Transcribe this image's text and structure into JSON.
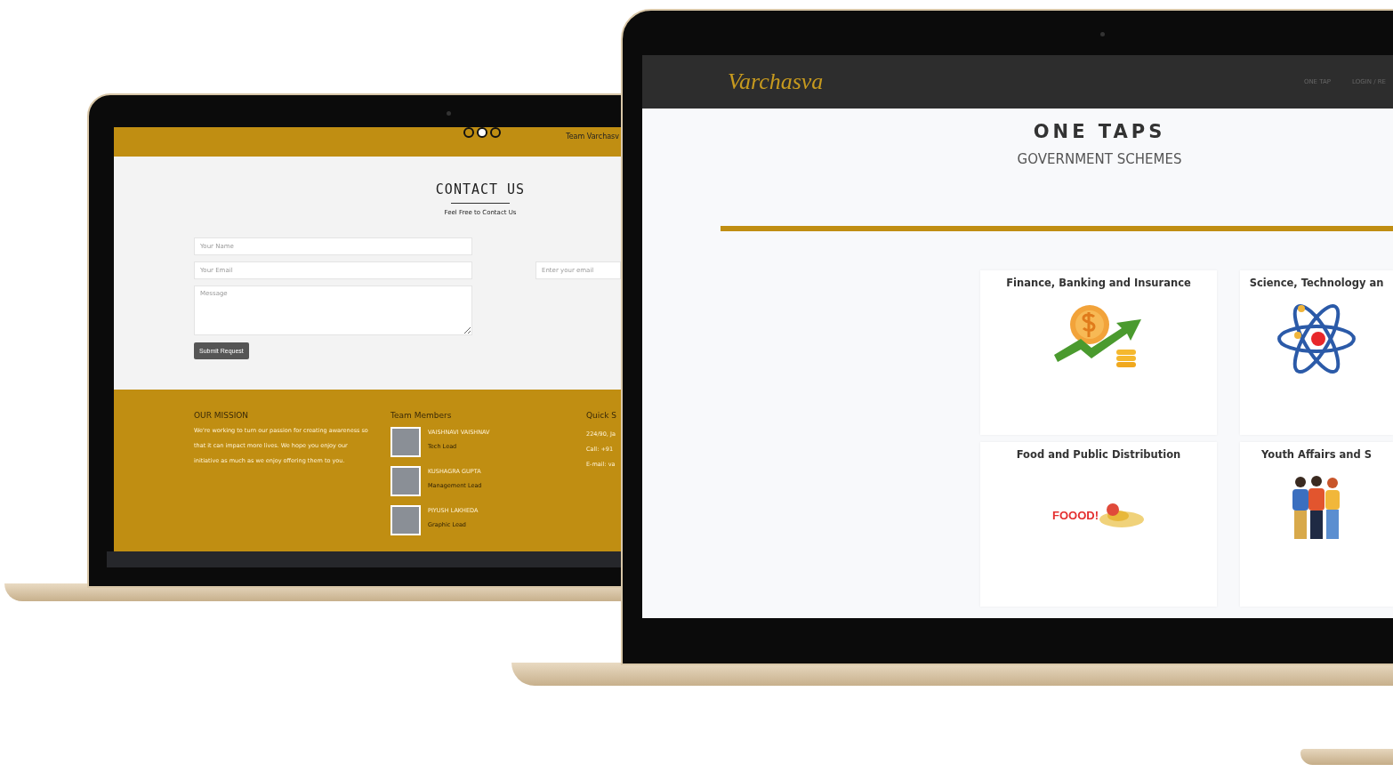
{
  "contact_page": {
    "header_text": "Team Varchasv",
    "pager_dots": [
      {
        "selected": false
      },
      {
        "selected": true
      },
      {
        "selected": false
      }
    ],
    "title": "CONTACT US",
    "subtitle": "Feel Free to Contact Us",
    "fields": [
      {
        "kind": "input",
        "placeholder": "Your Name"
      },
      {
        "kind": "input",
        "placeholder": "Your Email"
      },
      {
        "kind": "textarea",
        "placeholder": "Message"
      }
    ],
    "newsletter_field": {
      "placeholder": "Enter your email"
    },
    "submit_button": "Submit Request",
    "footer": {
      "mission": {
        "heading": "OUR MISSION",
        "text": "We're working to turn our passion for creating awareness so that it can impact more lives. We hope you enjoy our initiative as much as we enjoy offering them to you."
      },
      "team": {
        "heading": "Team Members",
        "members": [
          {
            "name": "VAISHNAVI VAISHNAV",
            "role": "Tech Lead"
          },
          {
            "name": "KUSHAGRA GUPTA",
            "role": "Management Lead"
          },
          {
            "name": "PIYUSH LAKHEDA",
            "role": "Graphic Lead"
          }
        ]
      },
      "quick": {
        "heading": "Quick S",
        "lines": [
          "224/90, Ja",
          "Call: +91 ",
          "E-mail: va"
        ]
      }
    }
  },
  "one_taps_page": {
    "logo": "Varchasva",
    "nav": [
      "ONE TAP",
      "LOGIN / RE"
    ],
    "title": "ONE TAPS",
    "subtitle": "GOVERNMENT SCHEMES",
    "categories": [
      {
        "kind": "finance",
        "title": "Finance, Banking and Insurance"
      },
      {
        "kind": "science",
        "title": "Science, Technology an"
      },
      {
        "kind": "food",
        "title": "Food and Public Distribution",
        "image_text": "FOOOD!"
      },
      {
        "kind": "youth",
        "title": "Youth Affairs and S"
      }
    ]
  }
}
